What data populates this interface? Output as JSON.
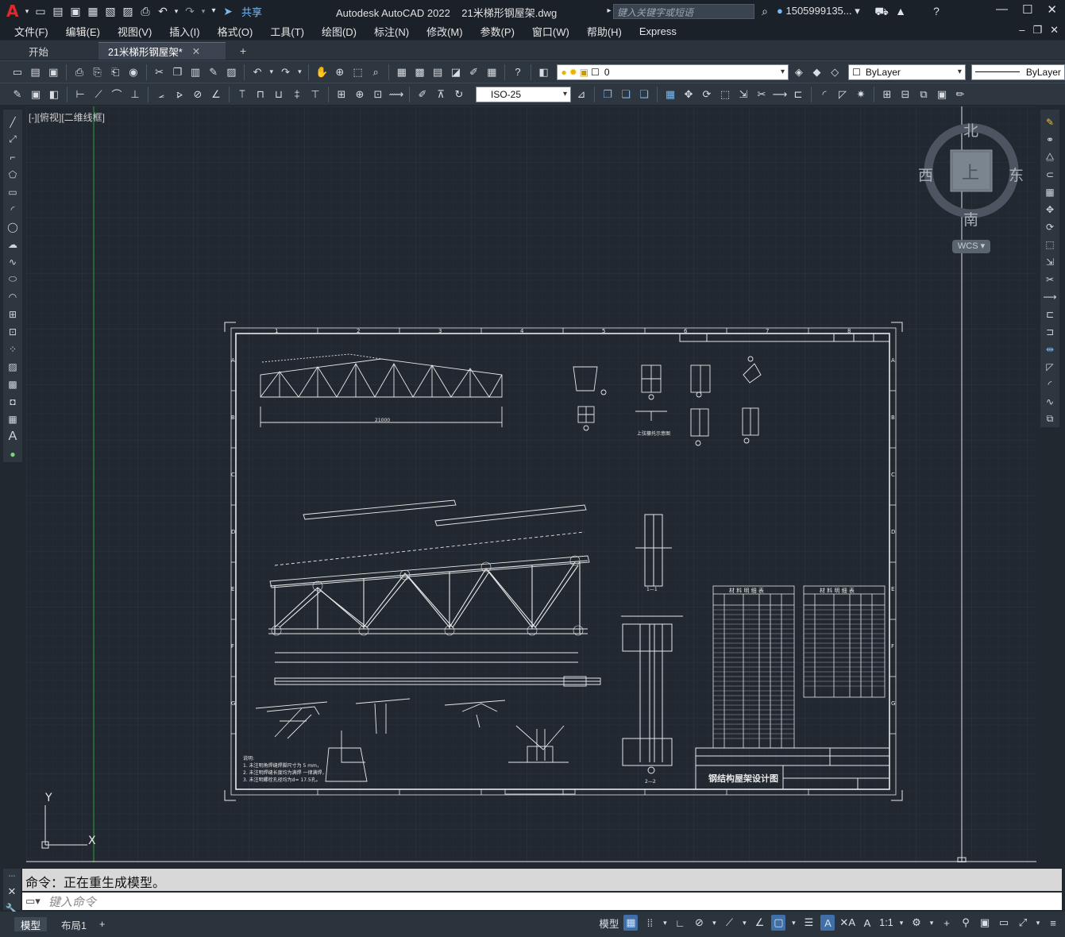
{
  "title_bar": {
    "app_title": "Autodesk AutoCAD 2022",
    "file_name": "21米梯形钢屋架.dwg",
    "share_label": "共享",
    "search_placeholder": "键入关键字或短语",
    "user": "1505999135... ▾"
  },
  "menu": [
    "文件(F)",
    "编辑(E)",
    "视图(V)",
    "插入(I)",
    "格式(O)",
    "工具(T)",
    "绘图(D)",
    "标注(N)",
    "修改(M)",
    "参数(P)",
    "窗口(W)",
    "帮助(H)",
    "Express"
  ],
  "file_tabs": [
    {
      "label": "开始",
      "active": false
    },
    {
      "label": "21米梯形钢屋架*",
      "active": true
    }
  ],
  "toolbar1": {
    "layer_value": "0",
    "color_value": "ByLayer",
    "linetype_value": "ByLayer"
  },
  "toolbar2": {
    "dimstyle_value": "ISO-25"
  },
  "viewport": {
    "view_label": "[-][俯视][二维线框]",
    "viewcube": {
      "north": "北",
      "south": "南",
      "east": "东",
      "west": "西",
      "face": "上"
    },
    "wcs_label": "WCS ▾",
    "ucs_x": "X",
    "ucs_y": "Y"
  },
  "drawing": {
    "col_numbers": [
      "1",
      "2",
      "3",
      "4",
      "5",
      "6",
      "7",
      "8"
    ],
    "row_letters": [
      "A",
      "B",
      "C",
      "D",
      "E",
      "F",
      "G"
    ],
    "title_block_text": "钢结构屋架设计图",
    "span_dim": "21000",
    "table1_title": "材 料 明 细 表",
    "table2_title": "材 料 明 细 表",
    "notes": [
      "说明:",
      "1. 未注明角焊缝焊脚尺寸为 5 mm，",
      "2. 未注明焊缝长度均为满焊 一律满焊，",
      "3. 未注明螺栓孔径均为d= 17.5孔。"
    ],
    "section_labels": [
      "1—1",
      "2—2",
      "上弦檩托示意图"
    ]
  },
  "command": {
    "history": "命令：正在重生成模型。",
    "placeholder": "键入命令"
  },
  "status": {
    "layout_tabs": [
      {
        "label": "模型",
        "active": true
      },
      {
        "label": "布局1",
        "active": false
      }
    ],
    "model_label": "模型",
    "scale": "1:1"
  }
}
